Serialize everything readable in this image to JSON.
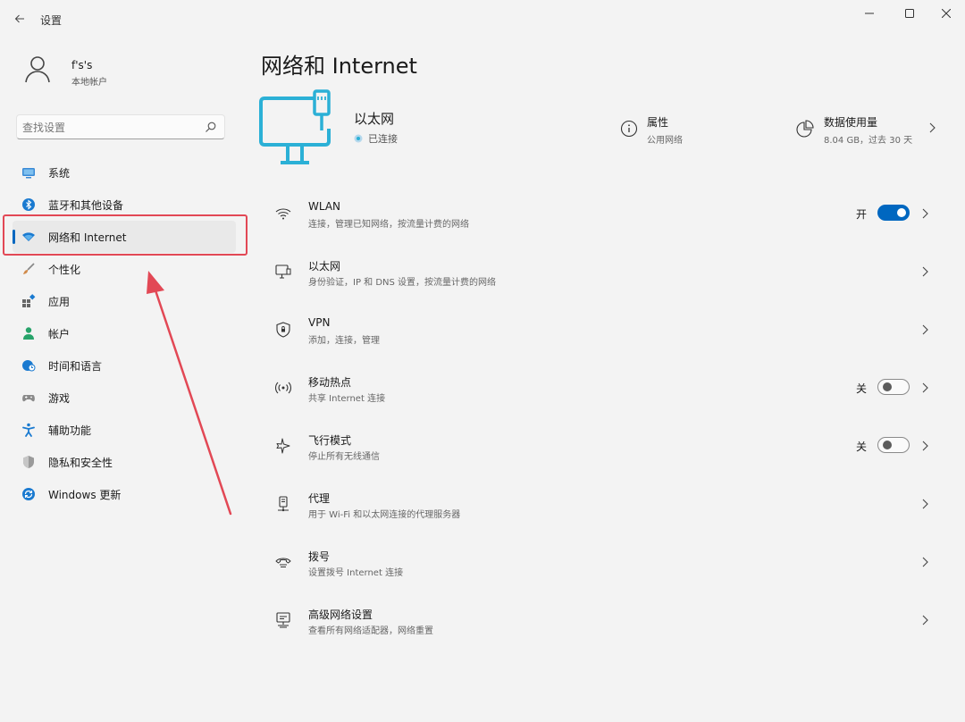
{
  "window": {
    "title": "设置",
    "back_icon": "arrow-left-icon",
    "controls": [
      "minimize-icon",
      "maximize-icon",
      "close-icon"
    ]
  },
  "user": {
    "name": "f's's",
    "account_type": "本地帐户"
  },
  "search": {
    "placeholder": "查找设置"
  },
  "sidebar": {
    "items": [
      {
        "label": "系统",
        "icon": "display-icon",
        "color": "#3a8ad6"
      },
      {
        "label": "蓝牙和其他设备",
        "icon": "bluetooth-icon",
        "color": "#1a7ad0"
      },
      {
        "label": "网络和 Internet",
        "icon": "wifi-icon",
        "color": "#1a7ad0",
        "active": true
      },
      {
        "label": "个性化",
        "icon": "brush-icon",
        "color": "#d08a4a"
      },
      {
        "label": "应用",
        "icon": "apps-icon",
        "color": "#555"
      },
      {
        "label": "帐户",
        "icon": "person-icon",
        "color": "#27a36a"
      },
      {
        "label": "时间和语言",
        "icon": "globe-clock-icon",
        "color": "#1a7ad0"
      },
      {
        "label": "游戏",
        "icon": "gamepad-icon",
        "color": "#777"
      },
      {
        "label": "辅助功能",
        "icon": "accessibility-icon",
        "color": "#1a7ad0"
      },
      {
        "label": "隐私和安全性",
        "icon": "shield-icon",
        "color": "#888"
      },
      {
        "label": "Windows 更新",
        "icon": "sync-icon",
        "color": "#1a7ad0"
      }
    ]
  },
  "main": {
    "title": "网络和 Internet",
    "ethernet": {
      "title": "以太网",
      "status": "已连接",
      "properties_label": "属性",
      "properties_sub": "公用网络",
      "data_label": "数据使用量",
      "data_sub": "8.04 GB，过去 30 天"
    },
    "rows": [
      {
        "title": "WLAN",
        "subtitle": "连接，管理已知网络，按流量计费的网络",
        "icon": "wifi-icon",
        "state": "开",
        "toggle": "on"
      },
      {
        "title": "以太网",
        "subtitle": "身份验证，IP 和 DNS 设置，按流量计费的网络",
        "icon": "ethernet-icon"
      },
      {
        "title": "VPN",
        "subtitle": "添加，连接，管理",
        "icon": "vpn-shield-icon"
      },
      {
        "title": "移动热点",
        "subtitle": "共享 Internet 连接",
        "icon": "hotspot-icon",
        "state": "关",
        "toggle": "off"
      },
      {
        "title": "飞行模式",
        "subtitle": "停止所有无线通信",
        "icon": "airplane-icon",
        "state": "关",
        "toggle": "off"
      },
      {
        "title": "代理",
        "subtitle": "用于 Wi-Fi 和以太网连接的代理服务器",
        "icon": "proxy-icon"
      },
      {
        "title": "拨号",
        "subtitle": "设置拨号 Internet 连接",
        "icon": "dialup-icon"
      },
      {
        "title": "高级网络设置",
        "subtitle": "查看所有网络适配器，网络重置",
        "icon": "advanced-network-icon"
      }
    ]
  },
  "colors": {
    "accent": "#0067c0",
    "monitor": "#2bb0d6",
    "annotation": "#e24855"
  }
}
